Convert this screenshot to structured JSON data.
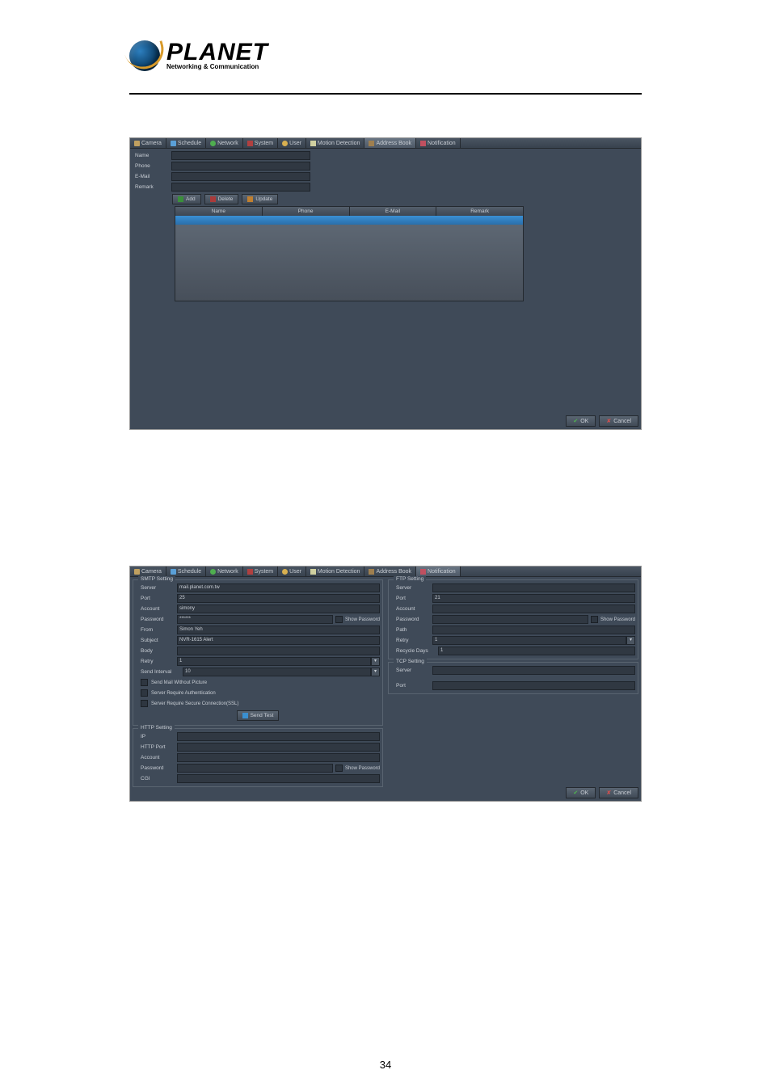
{
  "logo": {
    "name": "PLANET",
    "tagline": "Networking & Communication"
  },
  "page_number": "34",
  "tabs": {
    "camera": "Camera",
    "schedule": "Schedule",
    "network": "Network",
    "system": "System",
    "user": "User",
    "motion": "Motion Detection",
    "address": "Address Book",
    "notification": "Notification"
  },
  "shot1": {
    "labels": {
      "name": "Name",
      "phone": "Phone",
      "email": "E-Mail",
      "remark": "Remark"
    },
    "buttons": {
      "add": "Add",
      "delete": "Delete",
      "update": "Update"
    },
    "columns": {
      "name": "Name",
      "phone": "Phone",
      "email": "E-Mail",
      "remark": "Remark"
    }
  },
  "shot2": {
    "smtp": {
      "title": "SMTP Setting",
      "server_l": "Server",
      "server_v": "mail.planet.com.tw",
      "port_l": "Port",
      "port_v": "25",
      "account_l": "Account",
      "account_v": "simony",
      "password_l": "Password",
      "password_v": "******",
      "showpw": "Show Password",
      "from_l": "From",
      "from_v": "Simon Yeh",
      "subject_l": "Subject",
      "subject_v": "NVR-1615 Alert",
      "body_l": "Body",
      "retry_l": "Retry",
      "retry_v": "1",
      "interval_l": "Send Interval",
      "interval_v": "10",
      "opt1": "Send Mail Without Picture",
      "opt2": "Server Require Authentication",
      "opt3": "Server Require Secure Connection(SSL)",
      "sendtest": "Send Test"
    },
    "ftp": {
      "title": "FTP Setting",
      "server_l": "Server",
      "port_l": "Port",
      "port_v": "21",
      "account_l": "Account",
      "password_l": "Password",
      "showpw": "Show Password",
      "path_l": "Path",
      "retry_l": "Retry",
      "retry_v": "1",
      "recycle_l": "Recycle Days",
      "recycle_v": "1"
    },
    "tcp": {
      "title": "TCP Setting",
      "server_l": "Server",
      "port_l": "Port"
    },
    "http": {
      "title": "HTTP Setting",
      "ip_l": "IP",
      "port_l": "HTTP Port",
      "account_l": "Account",
      "password_l": "Password",
      "showpw": "Show Password",
      "cgi_l": "CGI"
    }
  },
  "footer": {
    "ok": "OK",
    "cancel": "Cancel"
  }
}
